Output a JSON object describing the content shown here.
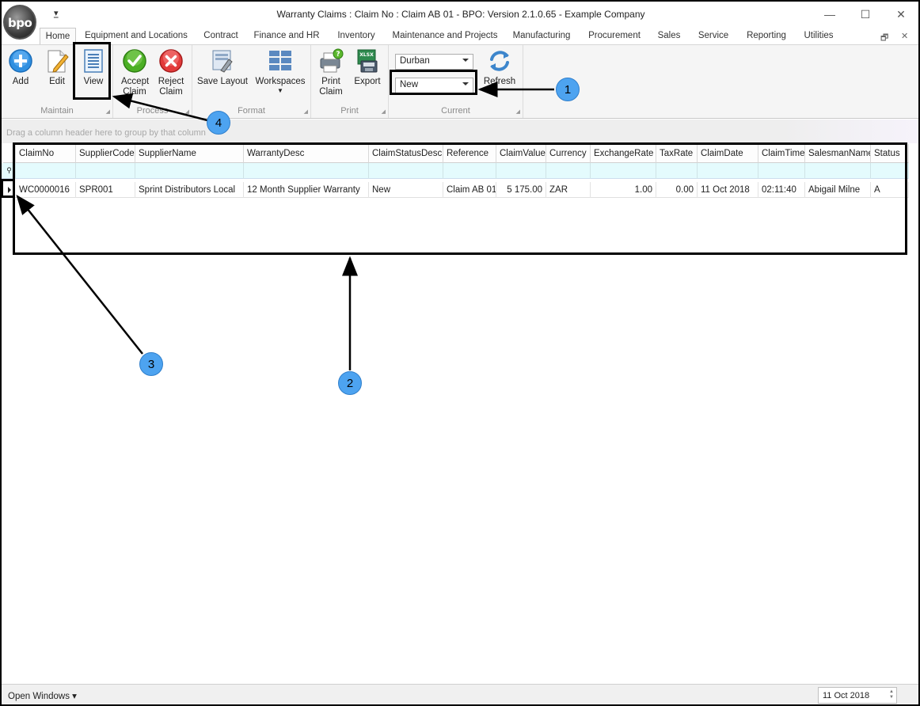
{
  "window": {
    "title": "Warranty Claims : Claim No : Claim AB 01 - BPO: Version 2.1.0.65 - Example Company",
    "logo_text": "bpo",
    "qat_icon": "dropdown-arrow",
    "minimize_icon": "—",
    "maximize_icon": "☐",
    "close_icon": "✕"
  },
  "tabs": {
    "items": [
      {
        "label": "Home",
        "active": true
      },
      {
        "label": "Equipment and Locations"
      },
      {
        "label": "Contract"
      },
      {
        "label": "Finance and HR"
      },
      {
        "label": "Inventory"
      },
      {
        "label": "Maintenance and Projects"
      },
      {
        "label": "Manufacturing"
      },
      {
        "label": "Procurement"
      },
      {
        "label": "Sales"
      },
      {
        "label": "Service"
      },
      {
        "label": "Reporting"
      },
      {
        "label": "Utilities"
      }
    ],
    "restore_icon": "🗗",
    "close_icon": "✕"
  },
  "ribbon": {
    "maintain": {
      "label": "Maintain",
      "add": "Add",
      "edit": "Edit",
      "view": "View"
    },
    "process": {
      "label": "Process",
      "accept": "Accept Claim",
      "reject": "Reject Claim"
    },
    "format": {
      "label": "Format",
      "save_layout": "Save Layout",
      "workspaces": "Workspaces"
    },
    "print": {
      "label": "Print",
      "print_claim": "Print Claim",
      "export": "Export",
      "export_badge": "XLSX"
    },
    "current": {
      "label": "Current",
      "site": "Durban",
      "status": "New",
      "refresh": "Refresh"
    }
  },
  "groupby": {
    "hint": "Drag a column header here to group by that column"
  },
  "grid": {
    "columns": [
      "ClaimNo",
      "SupplierCode",
      "SupplierName",
      "WarrantyDesc",
      "ClaimStatusDesc",
      "Reference",
      "ClaimValue",
      "Currency",
      "ExchangeRate",
      "TaxRate",
      "ClaimDate",
      "ClaimTime",
      "SalesmanName",
      "Status"
    ],
    "rows": [
      {
        "ClaimNo": "WC0000016",
        "SupplierCode": "SPR001",
        "SupplierName": "Sprint Distributors Local",
        "WarrantyDesc": "12 Month Supplier Warranty",
        "ClaimStatusDesc": "New",
        "Reference": "Claim AB 01",
        "ClaimValue": "5 175.00",
        "Currency": "ZAR",
        "ExchangeRate": "1.00",
        "TaxRate": "0.00",
        "ClaimDate": "11 Oct 2018",
        "ClaimTime": "02:11:40",
        "SalesmanName": "Abigail Milne",
        "Status": "A"
      }
    ]
  },
  "callouts": {
    "one": "1",
    "two": "2",
    "three": "3",
    "four": "4"
  },
  "statusbar": {
    "open_windows": "Open Windows ▾",
    "date": "11 Oct 2018"
  },
  "colors": {
    "callout": "#4da3f0",
    "accept": "#4caf25",
    "reject": "#e23b3b",
    "add": "#2f8fe0",
    "filter_row": "#e4fbfd"
  }
}
